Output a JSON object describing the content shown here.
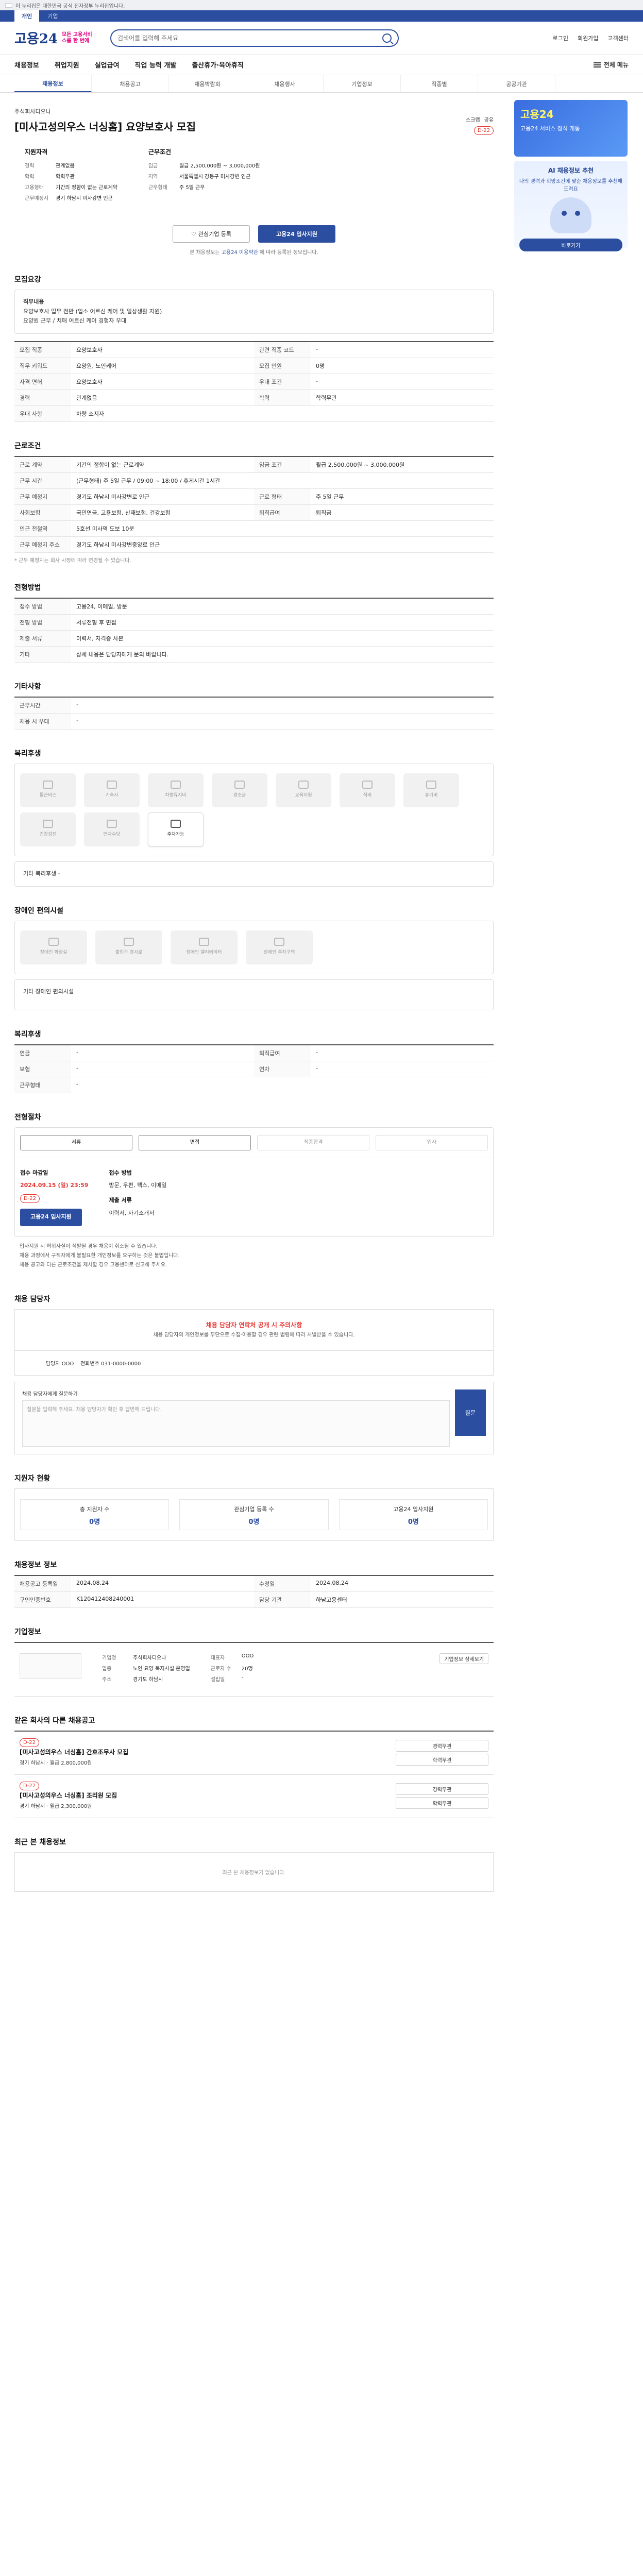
{
  "gov": {
    "notice": "이 누리집은 대한민국 공식 전자정부 누리집입니다."
  },
  "topstrip": [
    "개인",
    "기업"
  ],
  "header": {
    "logo_text": "고용24",
    "logo_sub": "모든 고용서비스를 한 번에",
    "search_placeholder": "검색어를 입력해 주세요",
    "links": [
      "로그인",
      "회원가입",
      "고객센터"
    ]
  },
  "gnb": [
    "채용정보",
    "취업지원",
    "실업급여",
    "직업 능력 개발",
    "출산휴가·육아휴직"
  ],
  "gnb_all": "전체 메뉴",
  "subtabs": [
    "채용정보",
    "채용공고",
    "채용박람회",
    "채용행사",
    "기업정보",
    "직종별",
    "공공기관"
  ],
  "side": {
    "ad_big": "고용24",
    "ad_text": "고용24 서비스 정식 개통",
    "promo_title": "AI 채용정보 추천",
    "promo_text": "나의 경력과 희망조건에 맞춘 채용정보를 추천해 드려요",
    "promo_btn": "바로가기"
  },
  "job": {
    "company": "주식회사디오나",
    "title": "[미사고성의우스 너싱홈] 요양보호사 모집",
    "bookmark": "스크랩",
    "share": "공유",
    "dday": "D-22",
    "card1_title": "지원자격",
    "card1": [
      {
        "k": "경력",
        "v": "관계없음"
      },
      {
        "k": "학력",
        "v": "학력무관"
      },
      {
        "k": "고용형태",
        "v": "기간의 정함이 없는 근로계약"
      },
      {
        "k": "근무예정지",
        "v": "경기 하남시 미사강변 인근"
      }
    ],
    "card2_title": "근무조건",
    "card2": [
      {
        "k": "임금",
        "v": "월급 2,500,000원 ~ 3,000,000원"
      },
      {
        "k": "지역",
        "v": "서울특별시 강동구 미사강변 인근"
      },
      {
        "k": "근무형태",
        "v": "주 5일 근무"
      }
    ]
  },
  "actions": {
    "inquiry": "관심기업 등록",
    "apply": "고용24 입사지원"
  },
  "note": {
    "pre": "본 채용정보는",
    "blue": "고용24 이용약관",
    "post": "에 따라 등록된 정보입니다."
  },
  "summary": {
    "title": "모집요강",
    "duty_label": "직무내용",
    "duty_text": "요양보호사 업무 전반 (입소 어르신 케어 및 일상생활 지원)\n요양원 근무 / 치매 어르신 케어 경험자 우대"
  },
  "recruit_rows": [
    [
      "모집 직종",
      "요양보호사",
      "관련 직종 코드",
      "-"
    ],
    [
      "직무 키워드",
      "요양원, 노인케어",
      "모집 인원",
      "0명"
    ],
    [
      "자격 면허",
      "요양보호사",
      "우대 조건",
      "-"
    ],
    [
      "경력",
      "관계없음",
      "학력",
      "학력무관"
    ],
    [
      "우대 사항",
      "차량 소지자",
      "",
      ""
    ]
  ],
  "cond": {
    "title": "근로조건",
    "rows": [
      [
        "근로 계약",
        "기간의 정함이 없는 근로계약",
        "임금 조건",
        "월급 2,500,000원 ~ 3,000,000원"
      ],
      [
        "근무 시간",
        "(근무형태) 주 5일 근무 / 09:00 ~ 18:00 / 휴게시간 1시간",
        "",
        ""
      ],
      [
        "근무 예정지",
        "경기도 하남시 미사강변로 인근",
        "근로 형태",
        "주 5일 근무"
      ],
      [
        "사회보험",
        "국민연금, 고용보험, 산재보험, 건강보험",
        "퇴직급여",
        "퇴직금"
      ],
      [
        "인근 전철역",
        "5호선 미사역 도보 10분",
        "",
        ""
      ],
      [
        "근무 예정지 주소",
        "경기도 하남시 미사강변중앙로 인근",
        "",
        ""
      ]
    ],
    "note": "* 근무 예정지는 회사 사정에 따라 변경될 수 있습니다."
  },
  "etc": {
    "title": "전형방법",
    "rows": [
      [
        "접수 방법",
        "고용24, 이메일, 방문"
      ],
      [
        "전형 방법",
        "서류전형 후 면접"
      ],
      [
        "제출 서류",
        "이력서, 자격증 사본"
      ],
      [
        "기타",
        "상세 내용은 담당자에게 문의 바랍니다."
      ]
    ]
  },
  "apply_extra": {
    "title": "기타사항",
    "rows": [
      [
        "근무시간",
        "-"
      ],
      [
        "채용 시 우대",
        "-"
      ]
    ]
  },
  "welfare": {
    "title": "복리후생",
    "items": [
      "통근버스",
      "기숙사",
      "차량유지비",
      "경조금",
      "교육지원",
      "식비",
      "휴가비",
      "건강검진",
      "연차수당",
      "주차가능"
    ],
    "extra_label": "기타 복리후생",
    "extra_value": "-"
  },
  "disability": {
    "title": "장애인 편의시설",
    "items": [
      "장애인 화장실",
      "출입구 경사로",
      "장애인 엘리베이터",
      "장애인 주차구역"
    ],
    "extra_label": "기타 장애인 편의시설"
  },
  "benefit": {
    "title": "복리후생",
    "rows": [
      [
        "연금",
        "-",
        "퇴직급여",
        "-"
      ],
      [
        "보험",
        "-",
        "연차",
        "-"
      ],
      [
        "근무형태",
        "-",
        "",
        ""
      ]
    ]
  },
  "process": {
    "title": "전형절차",
    "steps": [
      "서류",
      "면접",
      "최종합격",
      "입사"
    ],
    "deadline_label": "접수 마감일",
    "deadline": "2024.09.15 (일) 23:59",
    "dday": "D-22",
    "apply_btn": "고용24 입사지원",
    "method_label": "접수 방법",
    "method": "방문, 우편, 팩스, 이메일",
    "doc_label": "제출 서류",
    "doc": "이력서, 자기소개서"
  },
  "bullets": [
    "입사지원 시 허위사실이 적발될 경우 채용이 취소될 수 있습니다.",
    "채용 과정에서 구직자에게 불필요한 개인정보를 요구하는 것은 불법입니다.",
    "채용 공고와 다른 근로조건을 제시할 경우 고용센터로 신고해 주세요."
  ],
  "contact": {
    "title": "채용 담당자",
    "warn_h": "채용 담당자 연락처 공개 시 주의사항",
    "warn_text": "채용 담당자의 개인정보를 무단으로 수집·이용할 경우 관련 법령에 따라 처벌받을 수 있습니다.",
    "name_label": "담당자",
    "name": "OOO",
    "phone_label": "전화번호",
    "phone": "031-0000-0000",
    "inq_label": "채용 담당자에게 질문하기",
    "inq_placeholder": "질문을 입력해 주세요. 채용 담당자가 확인 후 답변해 드립니다.",
    "inq_btn": "질문"
  },
  "status": {
    "title": "지원자 현황",
    "items": [
      {
        "k": "총 지원자 수",
        "v": "0명"
      },
      {
        "k": "관심기업 등록 수",
        "v": "0명"
      },
      {
        "k": "고용24 입사지원",
        "v": "0명"
      }
    ]
  },
  "info": {
    "title": "채용정보 정보",
    "rows": [
      [
        "채용공고 등록일",
        "2024.08.24",
        "수정일",
        "2024.08.24"
      ],
      [
        "구인인증번호",
        "K120412408240001",
        "담당 기관",
        "하남고용센터"
      ]
    ]
  },
  "enterprise": {
    "title": "기업정보",
    "rows": [
      [
        "기업명",
        "주식회사디오나"
      ],
      [
        "업종",
        "노인 요양 복지시설 운영업"
      ],
      [
        "주소",
        "경기도 하남시"
      ]
    ],
    "rows2": [
      [
        "대표자",
        "OOO"
      ],
      [
        "근로자 수",
        "20명"
      ],
      [
        "설립일",
        "-"
      ]
    ],
    "detail": "기업정보 상세보기"
  },
  "related": {
    "title": "같은 회사의 다른 채용공고",
    "items": [
      {
        "dday": "D-22",
        "title": "[미사고성의우스 너싱홈] 간호조무사 모집",
        "meta": "경기 하남시 · 월급 2,800,000원",
        "tags": [
          "경력무관",
          "학력무관"
        ]
      },
      {
        "dday": "D-22",
        "title": "[미사고성의우스 너싱홈] 조리원 모집",
        "meta": "경기 하남시 · 월급 2,300,000원",
        "tags": [
          "경력무관",
          "학력무관"
        ]
      }
    ]
  },
  "recent": {
    "title": "최근 본 채용정보",
    "empty": "최근 본 채용정보가 없습니다."
  }
}
